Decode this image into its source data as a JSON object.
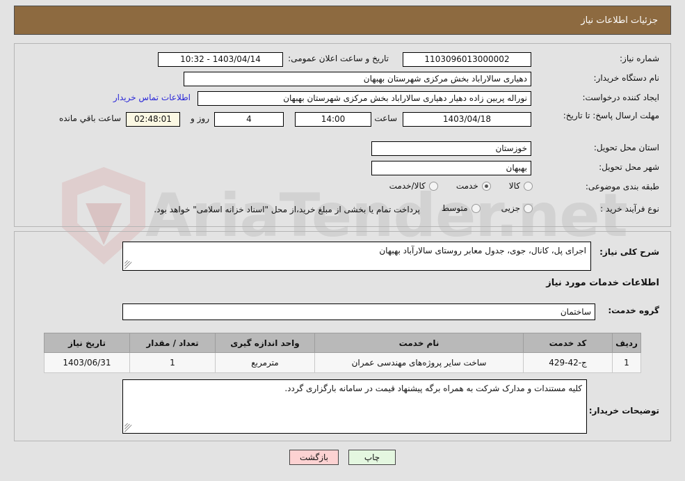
{
  "header": {
    "title": "جزئیات اطلاعات نیاز"
  },
  "watermark": {
    "text": "AriaTender.net",
    "shield_icon": "shield-icon"
  },
  "form": {
    "need_number": {
      "label": "شماره نیاز:",
      "value": "1103096013000002"
    },
    "announce_datetime": {
      "label": "تاریخ و ساعت اعلان عمومی:",
      "value": "1403/04/14 - 10:32"
    },
    "buyer_org": {
      "label": "نام دستگاه خریدار:",
      "value": "دهیاری سالاراباد بخش مرکزی شهرستان بهبهان"
    },
    "requester": {
      "label": "ایجاد کننده درخواست:",
      "value": "نوراله پربین زاده دهیار دهیاری سالاراباد بخش مرکزی شهرستان بهبهان"
    },
    "contact_link": {
      "label": "اطلاعات تماس خریدار"
    },
    "deadline": {
      "label": "مهلت ارسال پاسخ: تا تاریخ:",
      "date": "1403/04/18",
      "time_label": "ساعت",
      "time": "14:00",
      "days": "4",
      "days_suffix": "روز و",
      "countdown": "02:48:01",
      "countdown_suffix": "ساعت باقي مانده"
    },
    "province": {
      "label": "استان محل تحویل:",
      "value": "خوزستان"
    },
    "city": {
      "label": "شهر محل تحویل:",
      "value": "بهبهان"
    },
    "category": {
      "label": "طبقه بندی موضوعی:",
      "options": [
        {
          "label": "کالا",
          "selected": false
        },
        {
          "label": "خدمت",
          "selected": true
        },
        {
          "label": "کالا/خدمت",
          "selected": false
        }
      ]
    },
    "process_type": {
      "label": "نوع فرآیند خرید :",
      "options": [
        {
          "label": "جزیی",
          "selected": false
        },
        {
          "label": "متوسط",
          "selected": false
        }
      ],
      "note": "پرداخت تمام یا بخشی از مبلغ خرید،از محل \"اسناد خزانه اسلامی\" خواهد بود."
    },
    "general_description": {
      "label": "شرح کلی نیاز:",
      "value": "اجرای پل، کانال، جوی، جدول معابر روستای سالارآباد بهبهان"
    },
    "services_heading": "اطلاعات خدمات مورد نیاز",
    "service_group": {
      "label": "گروه خدمت:",
      "value": "ساختمان"
    },
    "buyer_notes": {
      "label": "توضیحات خریدار:",
      "value": "کلیه مستندات و مدارک شرکت به همراه برگه پیشنهاد قیمت در سامانه بارگزاری گردد."
    }
  },
  "table": {
    "columns": [
      "ردیف",
      "کد خدمت",
      "نام خدمت",
      "واحد اندازه گیری",
      "تعداد / مقدار",
      "تاریخ نیاز"
    ],
    "rows": [
      {
        "index": "1",
        "code": "ج-42-429",
        "name": "ساخت سایر پروژه‌های مهندسی عمران",
        "unit": "مترمربع",
        "quantity": "1",
        "need_date": "1403/06/31"
      }
    ]
  },
  "buttons": {
    "back": "بازگشت",
    "print": "چاپ"
  },
  "colors": {
    "header_bar": "#8d6a40",
    "link": "#2a27d8",
    "timer_bg": "#fbf8e3",
    "back_btn": "#fcd2d2",
    "print_btn": "#e4f7e0",
    "page_bg": "#e3e3e3"
  }
}
